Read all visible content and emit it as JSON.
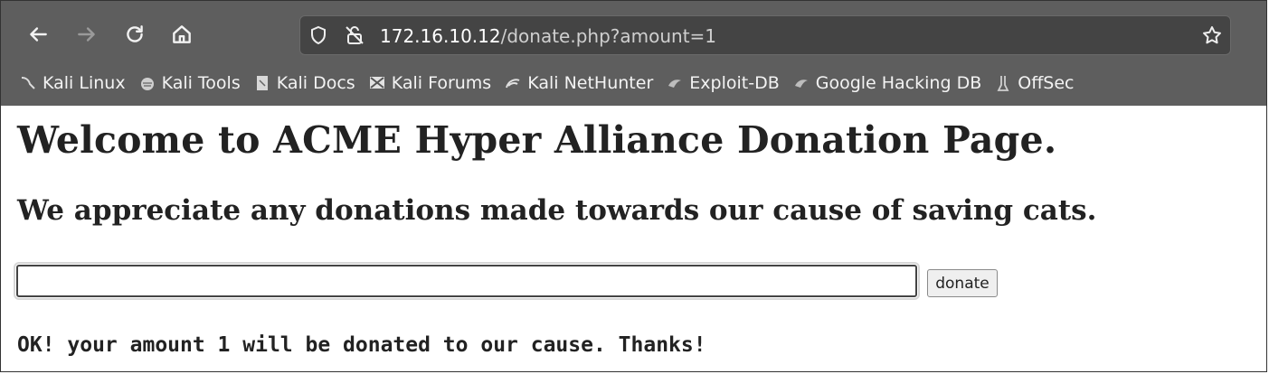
{
  "browser": {
    "url_host": "172.16.10.12",
    "url_path": "/donate.php?amount=1",
    "bookmarks": [
      {
        "label": "Kali Linux",
        "icon": "kali-dragon-icon"
      },
      {
        "label": "Kali Tools",
        "icon": "kali-tools-icon"
      },
      {
        "label": "Kali Docs",
        "icon": "kali-docs-icon"
      },
      {
        "label": "Kali Forums",
        "icon": "kali-forums-icon"
      },
      {
        "label": "Kali NetHunter",
        "icon": "kali-nethunter-icon"
      },
      {
        "label": "Exploit-DB",
        "icon": "exploit-db-icon"
      },
      {
        "label": "Google Hacking DB",
        "icon": "google-hacking-db-icon"
      },
      {
        "label": "OffSec",
        "icon": "offsec-icon"
      }
    ]
  },
  "page": {
    "heading": "Welcome to ACME Hyper Alliance Donation Page.",
    "subheading": "We appreciate any donations made towards our cause of saving cats.",
    "amount_value": "",
    "donate_label": "donate",
    "result_message": "OK! your amount 1 will be donated to our cause. Thanks!"
  }
}
